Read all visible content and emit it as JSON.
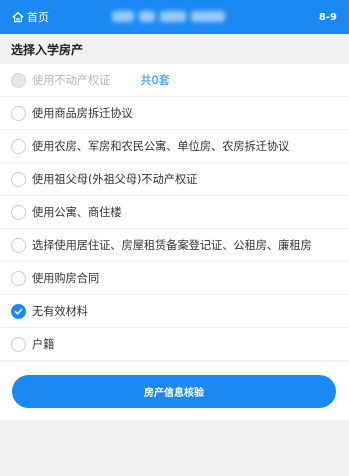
{
  "header": {
    "home_label": "首页",
    "step": "8-9"
  },
  "section": {
    "title": "选择入学房产"
  },
  "options": [
    {
      "label": "使用不动产权证",
      "count_text": "共0套",
      "state": "disabled"
    },
    {
      "label": "使用商品房拆迁协议",
      "state": "unchecked"
    },
    {
      "label": "使用农房、军房和农民公寓、单位房、农房拆迁协议",
      "state": "unchecked"
    },
    {
      "label": "使用祖父母(外祖父母)不动产权证",
      "state": "unchecked"
    },
    {
      "label": "使用公寓、商住楼",
      "state": "unchecked"
    },
    {
      "label": "选择使用居住证、房屋租赁备案登记证、公租房、廉租房",
      "state": "unchecked"
    },
    {
      "label": "使用购房合同",
      "state": "unchecked"
    },
    {
      "label": "无有效材料",
      "state": "checked"
    },
    {
      "label": "户籍",
      "state": "unchecked"
    }
  ],
  "footer": {
    "button_label": "房产信息核验"
  },
  "colors": {
    "accent": "#1a89f4",
    "background": "#f2f2f2"
  },
  "icons": {
    "home": "home-icon",
    "check": "checkmark-icon"
  }
}
